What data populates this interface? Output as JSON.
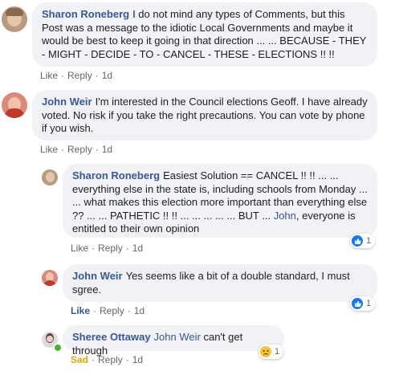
{
  "comments": [
    {
      "author": "Sharon Roneberg",
      "text": "I do not mind any types of Comments, but this Post was a message to the idiotic Local Governments and maybe it would be best to keep it going in that direction ... ... BECAUSE - THEY - MIGHT - DECIDE - TO - CANCEL - THESE - ELECTIONS !! !!",
      "like_label": "Like",
      "reply_label": "Reply",
      "time": "1d"
    },
    {
      "author": "John Weir",
      "text": "I'm interested in the Council elections Geoff. I have already voted. No risk if you take the right precautions. You can vote by phone if you wish.",
      "like_label": "Like",
      "reply_label": "Reply",
      "time": "1d"
    }
  ],
  "replies": [
    {
      "author": "Sharon Roneberg",
      "text_before": "Easiest Solution == CANCEL !! !! ... ... everything else in the state is, including schools from Monday ... ... what makes this election more important than everything else ?? ... ... PATHETIC !! !! ... ... ... ... ... BUT ...",
      "mention": "John",
      "text_after": ", everyone is entitled to their own opinion",
      "like_label": "Like",
      "reply_label": "Reply",
      "time": "1d",
      "reaction": {
        "type": "like",
        "count": "1"
      }
    },
    {
      "author": "John Weir",
      "text": "Yes seems like a bit of a double standard, I must sgree.",
      "like_label": "Like",
      "reply_label": "Reply",
      "time": "1d",
      "reaction": {
        "type": "like",
        "count": "1"
      }
    },
    {
      "author": "Sheree Ottaway",
      "mention": "John Weir",
      "text": "can't get through",
      "like_label": "Sad",
      "reply_label": "Reply",
      "time": "1d",
      "reaction": {
        "type": "sad",
        "count": "1"
      }
    }
  ],
  "separator": "·",
  "colors": {
    "bubble_bg": "#f0f2f5",
    "name": "#385898",
    "meta": "#606770",
    "like_blue": "#1877f2",
    "sad_yellow": "#f7c33c",
    "sad_label": "#e0a800"
  },
  "icons": {
    "like": "thumbs-up-icon",
    "sad": "sad-face-icon"
  }
}
